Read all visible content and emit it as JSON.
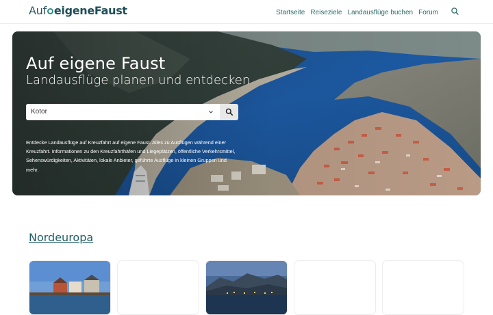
{
  "header": {
    "logo_prefix": "Auf",
    "logo_main": "eigeneFaust",
    "nav": [
      {
        "label": "Startseite"
      },
      {
        "label": "Reiseziele"
      },
      {
        "label": "Landausflüge buchen"
      },
      {
        "label": "Forum"
      }
    ],
    "search_icon": "search-icon"
  },
  "hero": {
    "title": "Auf eigene Faust",
    "subtitle": "Landausflüge planen und entdecken",
    "select_value": "Kotor",
    "description": "Entdecke Landausflüge auf Kreuzfahrt auf eigene Faust. Alles zu Ausflügen während einer Kreuzfahrt. Informationen zu den Kreuzfahrthäfen und Liegeplätzen, öffentliche Verkehrsmittel, Sehenswürdigkeiten, Aktivitäten, lokale Anbieter, geführte Ausflüge in kleinen Gruppen und mehr."
  },
  "section": {
    "title": "Nordeuropa"
  },
  "colors": {
    "brand": "#1f4f58",
    "accent": "#2d8f86",
    "nav_link": "#2b6b66"
  }
}
